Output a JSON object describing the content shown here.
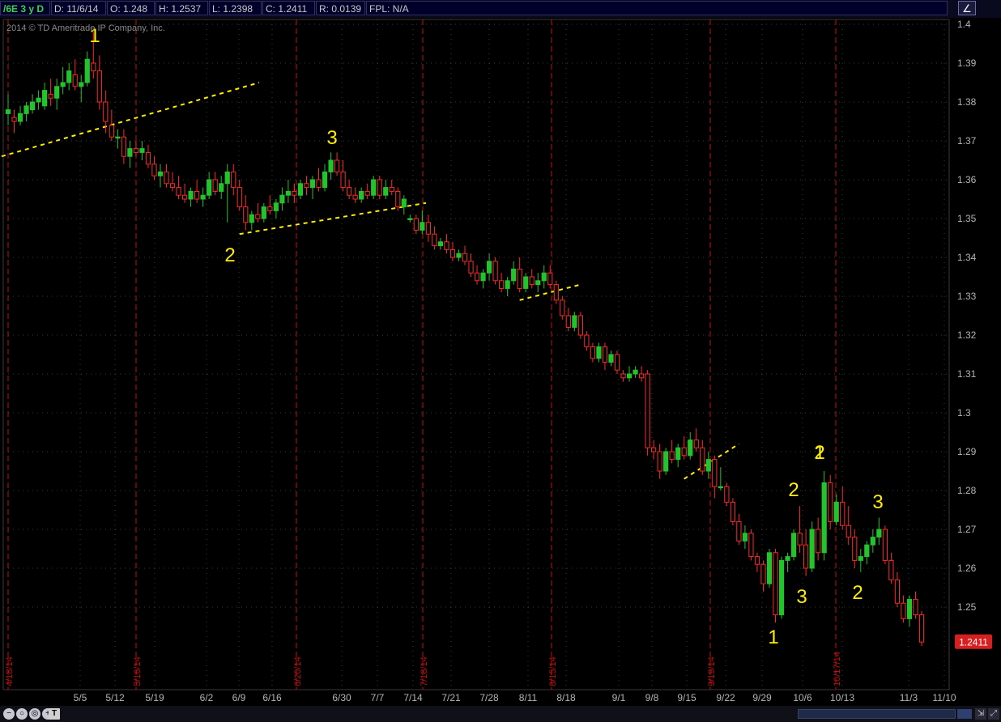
{
  "header": {
    "symbol": "/6E 3 y D",
    "date": "D: 11/6/14",
    "open": "O: 1.248",
    "high": "H: 1.2537",
    "low": "L: 1.2398",
    "close": "C: 1.2411",
    "range": "R: 0.0139",
    "fpl": "FPL: N/A",
    "chart_icon": "chart-style-icon"
  },
  "copyright": "2014 © TD Ameritrade IP Company, Inc.",
  "colors": {
    "background": "#000000",
    "up": "#22c32c",
    "down": "#ff2a2a",
    "grid": "#3a3a3a",
    "event_line": "#c41010",
    "annotation": "#ffee00",
    "price_tag": "#d81e1e"
  },
  "chart_data": {
    "type": "candlestick",
    "x_tick_labels": [
      "5/5",
      "5/12",
      "5/19",
      "6/2",
      "6/9",
      "6/16",
      "6/30",
      "7/7",
      "7/14",
      "7/21",
      "7/28",
      "8/11",
      "8/18",
      "9/1",
      "9/8",
      "9/15",
      "9/22",
      "9/29",
      "10/6",
      "10/13",
      "11/3",
      "11/10"
    ],
    "y_tick_labels": [
      "1.4",
      "1.39",
      "1.38",
      "1.37",
      "1.36",
      "1.35",
      "1.34",
      "1.33",
      "1.32",
      "1.31",
      "1.3",
      "1.29",
      "1.28",
      "1.27",
      "1.26",
      "1.25"
    ],
    "ylim": [
      1.2385,
      1.4
    ],
    "grid": "dotted",
    "event_lines": [
      "4/18/14",
      "5/16/14",
      "6/20/14",
      "7/18/14",
      "8/15/14",
      "9/19/14",
      "10/17/14"
    ],
    "last_price": "1.2411",
    "annotations": [
      "1",
      "2",
      "3",
      "1",
      "2",
      "3",
      "2",
      "1",
      "3",
      "2"
    ],
    "candles": [
      [
        1.377,
        1.382,
        1.374,
        1.378
      ],
      [
        1.376,
        1.378,
        1.372,
        1.375
      ],
      [
        1.375,
        1.379,
        1.374,
        1.377
      ],
      [
        1.377,
        1.38,
        1.375,
        1.379
      ],
      [
        1.378,
        1.382,
        1.377,
        1.38
      ],
      [
        1.38,
        1.383,
        1.378,
        1.381
      ],
      [
        1.379,
        1.385,
        1.378,
        1.383
      ],
      [
        1.382,
        1.386,
        1.379,
        1.381
      ],
      [
        1.381,
        1.386,
        1.378,
        1.384
      ],
      [
        1.384,
        1.389,
        1.382,
        1.385
      ],
      [
        1.385,
        1.39,
        1.383,
        1.388
      ],
      [
        1.387,
        1.391,
        1.383,
        1.384
      ],
      [
        1.384,
        1.387,
        1.38,
        1.385
      ],
      [
        1.385,
        1.393,
        1.384,
        1.391
      ],
      [
        1.39,
        1.398,
        1.386,
        1.388
      ],
      [
        1.388,
        1.392,
        1.378,
        1.38
      ],
      [
        1.38,
        1.383,
        1.372,
        1.375
      ],
      [
        1.374,
        1.378,
        1.37,
        1.371
      ],
      [
        1.371,
        1.373,
        1.368,
        1.371
      ],
      [
        1.371,
        1.373,
        1.364,
        1.366
      ],
      [
        1.366,
        1.37,
        1.363,
        1.368
      ],
      [
        1.368,
        1.37,
        1.366,
        1.367
      ],
      [
        1.367,
        1.37,
        1.365,
        1.368
      ],
      [
        1.367,
        1.369,
        1.363,
        1.364
      ],
      [
        1.364,
        1.366,
        1.36,
        1.361
      ],
      [
        1.361,
        1.364,
        1.358,
        1.362
      ],
      [
        1.362,
        1.364,
        1.358,
        1.359
      ],
      [
        1.359,
        1.362,
        1.357,
        1.358
      ],
      [
        1.358,
        1.361,
        1.355,
        1.356
      ],
      [
        1.356,
        1.359,
        1.354,
        1.355
      ],
      [
        1.355,
        1.358,
        1.353,
        1.357
      ],
      [
        1.357,
        1.36,
        1.354,
        1.355
      ],
      [
        1.355,
        1.358,
        1.353,
        1.356
      ],
      [
        1.356,
        1.362,
        1.355,
        1.36
      ],
      [
        1.36,
        1.362,
        1.356,
        1.357
      ],
      [
        1.357,
        1.361,
        1.355,
        1.359
      ],
      [
        1.359,
        1.364,
        1.349,
        1.362
      ],
      [
        1.362,
        1.364,
        1.356,
        1.358
      ],
      [
        1.358,
        1.36,
        1.352,
        1.353
      ],
      [
        1.353,
        1.356,
        1.347,
        1.349
      ],
      [
        1.349,
        1.352,
        1.347,
        1.351
      ],
      [
        1.351,
        1.354,
        1.349,
        1.35
      ],
      [
        1.35,
        1.354,
        1.349,
        1.353
      ],
      [
        1.353,
        1.356,
        1.351,
        1.352
      ],
      [
        1.352,
        1.355,
        1.35,
        1.354
      ],
      [
        1.354,
        1.358,
        1.352,
        1.356
      ],
      [
        1.356,
        1.36,
        1.354,
        1.357
      ],
      [
        1.357,
        1.359,
        1.354,
        1.356
      ],
      [
        1.356,
        1.36,
        1.355,
        1.359
      ],
      [
        1.359,
        1.361,
        1.356,
        1.358
      ],
      [
        1.358,
        1.361,
        1.355,
        1.36
      ],
      [
        1.36,
        1.363,
        1.357,
        1.358
      ],
      [
        1.358,
        1.364,
        1.357,
        1.362
      ],
      [
        1.362,
        1.367,
        1.36,
        1.365
      ],
      [
        1.365,
        1.367,
        1.361,
        1.362
      ],
      [
        1.362,
        1.365,
        1.357,
        1.358
      ],
      [
        1.358,
        1.36,
        1.355,
        1.356
      ],
      [
        1.356,
        1.358,
        1.354,
        1.355
      ],
      [
        1.355,
        1.358,
        1.354,
        1.357
      ],
      [
        1.357,
        1.359,
        1.355,
        1.356
      ],
      [
        1.356,
        1.361,
        1.355,
        1.36
      ],
      [
        1.36,
        1.361,
        1.355,
        1.356
      ],
      [
        1.356,
        1.36,
        1.355,
        1.358
      ],
      [
        1.358,
        1.36,
        1.356,
        1.357
      ],
      [
        1.357,
        1.358,
        1.352,
        1.353
      ],
      [
        1.353,
        1.356,
        1.351,
        1.355
      ],
      [
        1.35,
        1.351,
        1.349,
        1.35
      ],
      [
        1.35,
        1.351,
        1.346,
        1.347
      ],
      [
        1.347,
        1.352,
        1.346,
        1.349
      ],
      [
        1.349,
        1.351,
        1.344,
        1.346
      ],
      [
        1.346,
        1.348,
        1.342,
        1.343
      ],
      [
        1.343,
        1.345,
        1.342,
        1.344
      ],
      [
        1.344,
        1.346,
        1.341,
        1.342
      ],
      [
        1.342,
        1.344,
        1.339,
        1.34
      ],
      [
        1.34,
        1.342,
        1.339,
        1.341
      ],
      [
        1.341,
        1.343,
        1.338,
        1.339
      ],
      [
        1.339,
        1.341,
        1.335,
        1.336
      ],
      [
        1.336,
        1.338,
        1.333,
        1.334
      ],
      [
        1.334,
        1.337,
        1.332,
        1.336
      ],
      [
        1.336,
        1.341,
        1.334,
        1.339
      ],
      [
        1.339,
        1.34,
        1.333,
        1.334
      ],
      [
        1.334,
        1.336,
        1.331,
        1.332
      ],
      [
        1.332,
        1.335,
        1.33,
        1.334
      ],
      [
        1.334,
        1.339,
        1.333,
        1.337
      ],
      [
        1.337,
        1.34,
        1.331,
        1.332
      ],
      [
        1.332,
        1.336,
        1.331,
        1.335
      ],
      [
        1.335,
        1.337,
        1.332,
        1.333
      ],
      [
        1.333,
        1.336,
        1.331,
        1.334
      ],
      [
        1.334,
        1.338,
        1.332,
        1.336
      ],
      [
        1.336,
        1.338,
        1.332,
        1.333
      ],
      [
        1.333,
        1.334,
        1.328,
        1.329
      ],
      [
        1.329,
        1.33,
        1.324,
        1.325
      ],
      [
        1.325,
        1.327,
        1.321,
        1.322
      ],
      [
        1.322,
        1.326,
        1.321,
        1.325
      ],
      [
        1.325,
        1.326,
        1.319,
        1.32
      ],
      [
        1.32,
        1.321,
        1.316,
        1.317
      ],
      [
        1.317,
        1.318,
        1.313,
        1.314
      ],
      [
        1.314,
        1.318,
        1.313,
        1.317
      ],
      [
        1.317,
        1.318,
        1.311,
        1.313
      ],
      [
        1.313,
        1.316,
        1.312,
        1.315
      ],
      [
        1.315,
        1.316,
        1.31,
        1.311
      ],
      [
        1.31,
        1.311,
        1.308,
        1.309
      ],
      [
        1.309,
        1.312,
        1.308,
        1.31
      ],
      [
        1.31,
        1.312,
        1.309,
        1.311
      ],
      [
        1.31,
        1.312,
        1.308,
        1.309
      ],
      [
        1.31,
        1.311,
        1.289,
        1.291
      ],
      [
        1.291,
        1.293,
        1.288,
        1.29
      ],
      [
        1.29,
        1.292,
        1.283,
        1.285
      ],
      [
        1.285,
        1.291,
        1.284,
        1.29
      ],
      [
        1.29,
        1.293,
        1.287,
        1.288
      ],
      [
        1.288,
        1.292,
        1.286,
        1.291
      ],
      [
        1.291,
        1.294,
        1.288,
        1.289
      ],
      [
        1.289,
        1.295,
        1.288,
        1.293
      ],
      [
        1.293,
        1.296,
        1.29,
        1.291
      ],
      [
        1.291,
        1.293,
        1.284,
        1.285
      ],
      [
        1.285,
        1.29,
        1.283,
        1.288
      ],
      [
        1.288,
        1.289,
        1.278,
        1.281
      ],
      [
        1.281,
        1.286,
        1.28,
        1.281
      ],
      [
        1.281,
        1.282,
        1.276,
        1.277
      ],
      [
        1.277,
        1.278,
        1.271,
        1.272
      ],
      [
        1.272,
        1.274,
        1.266,
        1.267
      ],
      [
        1.267,
        1.271,
        1.265,
        1.269
      ],
      [
        1.269,
        1.27,
        1.262,
        1.263
      ],
      [
        1.263,
        1.264,
        1.259,
        1.261
      ],
      [
        1.261,
        1.262,
        1.254,
        1.256
      ],
      [
        1.256,
        1.265,
        1.255,
        1.264
      ],
      [
        1.264,
        1.265,
        1.246,
        1.248
      ],
      [
        1.248,
        1.263,
        1.247,
        1.262
      ],
      [
        1.262,
        1.264,
        1.259,
        1.263
      ],
      [
        1.263,
        1.27,
        1.262,
        1.269
      ],
      [
        1.269,
        1.276,
        1.264,
        1.266
      ],
      [
        1.266,
        1.27,
        1.258,
        1.26
      ],
      [
        1.26,
        1.272,
        1.259,
        1.27
      ],
      [
        1.27,
        1.273,
        1.262,
        1.264
      ],
      [
        1.264,
        1.285,
        1.262,
        1.282
      ],
      [
        1.282,
        1.284,
        1.27,
        1.272
      ],
      [
        1.272,
        1.279,
        1.271,
        1.277
      ],
      [
        1.277,
        1.281,
        1.27,
        1.271
      ],
      [
        1.271,
        1.276,
        1.266,
        1.268
      ],
      [
        1.268,
        1.27,
        1.26,
        1.262
      ],
      [
        1.262,
        1.265,
        1.259,
        1.263
      ],
      [
        1.263,
        1.267,
        1.261,
        1.266
      ],
      [
        1.266,
        1.27,
        1.264,
        1.268
      ],
      [
        1.268,
        1.273,
        1.266,
        1.27
      ],
      [
        1.27,
        1.271,
        1.261,
        1.262
      ],
      [
        1.262,
        1.264,
        1.256,
        1.257
      ],
      [
        1.257,
        1.259,
        1.25,
        1.251
      ],
      [
        1.251,
        1.253,
        1.246,
        1.247
      ],
      [
        1.247,
        1.253,
        1.245,
        1.252
      ],
      [
        1.252,
        1.254,
        1.247,
        1.248
      ],
      [
        1.248,
        1.249,
        1.24,
        1.241
      ]
    ]
  }
}
